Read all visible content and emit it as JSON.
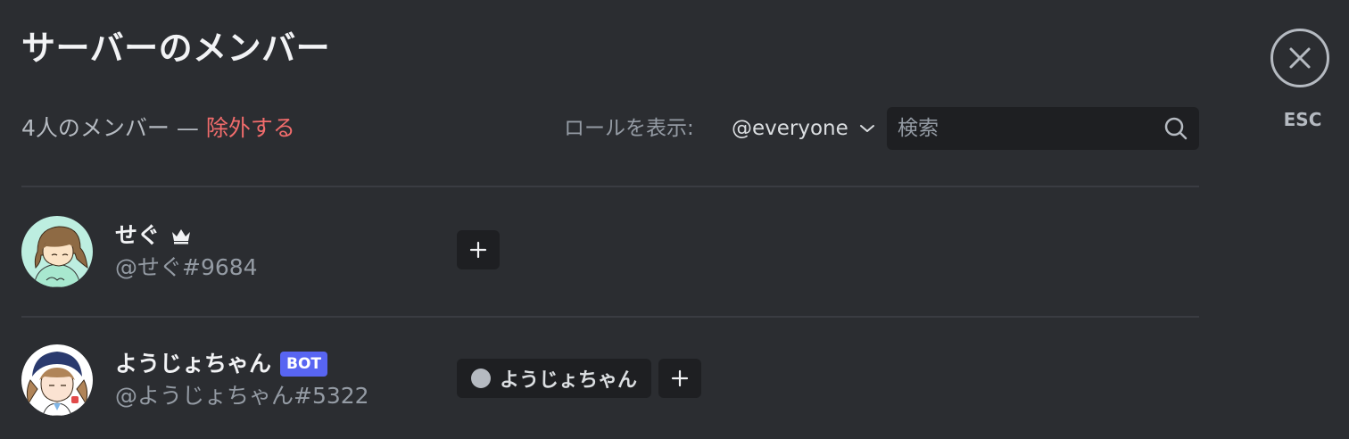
{
  "header": {
    "title": "サーバーのメンバー",
    "close_label": "ESC"
  },
  "toolbar": {
    "member_count": "4人のメンバー — ",
    "prune_label": "除外する",
    "role_filter_label": "ロールを表示:",
    "role_filter_value": "@everyone",
    "search_placeholder": "検索"
  },
  "members": [
    {
      "name": "せぐ",
      "handle": "@せぐ#9684",
      "is_owner": true,
      "roles": []
    },
    {
      "name": "ようじょちゃん",
      "handle": "@ようじょちゃん#5322",
      "badge": "BOT",
      "roles": [
        {
          "name": "ようじょちゃん",
          "color": "#b5bac1"
        }
      ]
    }
  ],
  "colors": {
    "background": "#2b2d31",
    "danger": "#f16c6c",
    "bot_badge": "#5865f2",
    "input_bg": "#1e1f22"
  }
}
